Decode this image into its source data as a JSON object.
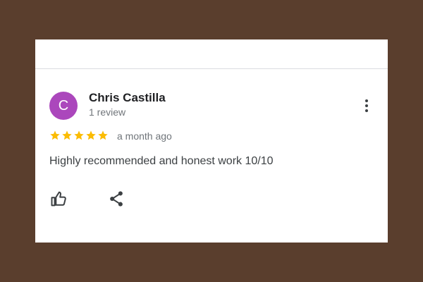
{
  "review": {
    "author_initial": "C",
    "author_name": "Chris Castilla",
    "author_review_count": "1 review",
    "rating": 5,
    "rating_max": 5,
    "date": "a month ago",
    "text": "Highly recommended and honest work 10/10"
  },
  "icons": {
    "more": "more-vert-icon",
    "like": "thumb-up-icon",
    "share": "share-icon",
    "star": "star-icon"
  },
  "colors": {
    "background": "#5a3e2d",
    "card": "#ffffff",
    "avatar": "#ab47bc",
    "star": "#fbbc04"
  }
}
